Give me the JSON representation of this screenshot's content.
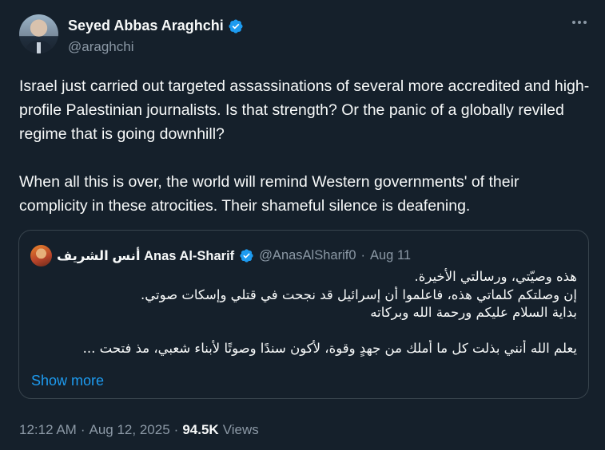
{
  "author": {
    "display_name": "Seyed Abbas Araghchi",
    "handle": "@araghchi"
  },
  "tweet": {
    "text": "Israel just carried out targeted assassinations of several more accredited and high-profile Palestinian journalists. Is that strength? Or the panic of a globally reviled regime that is going downhill?\n\nWhen all this is over, the world will remind Western governments' of their complicity in these atrocities. Their shameful silence is deafening."
  },
  "quote": {
    "display_name": "أنس الشريف Anas Al-Sharif",
    "handle": "@AnasAlSharif0",
    "separator": "·",
    "date": "Aug 11",
    "lines": [
      "هذه وصيّتي، ورسالتي الأخيرة.",
      "إن وصلتكم كلماتي هذه، فاعلموا أن إسرائيل قد نجحت في قتلي وإسكات صوتي.",
      "بداية السلام عليكم ورحمة الله وبركاته",
      "",
      "يعلم الله أنني بذلت كل ما أملك من جهدٍ وقوة، لأكون سندًا وصوتًا لأبناء شعبي، مذ فتحت ..."
    ],
    "show_more_label": "Show more"
  },
  "meta": {
    "time": "12:12 AM",
    "separator1": "·",
    "date": "Aug 12, 2025",
    "separator2": "·",
    "views_count": "94.5K",
    "views_label": "Views"
  },
  "icons": {
    "verified": "verified-badge-icon",
    "more": "more-options-icon"
  },
  "colors": {
    "background": "#15202b",
    "text": "#f7f9f9",
    "secondary": "#8b98a5",
    "accent": "#1d9bf0",
    "border": "#38444d"
  }
}
